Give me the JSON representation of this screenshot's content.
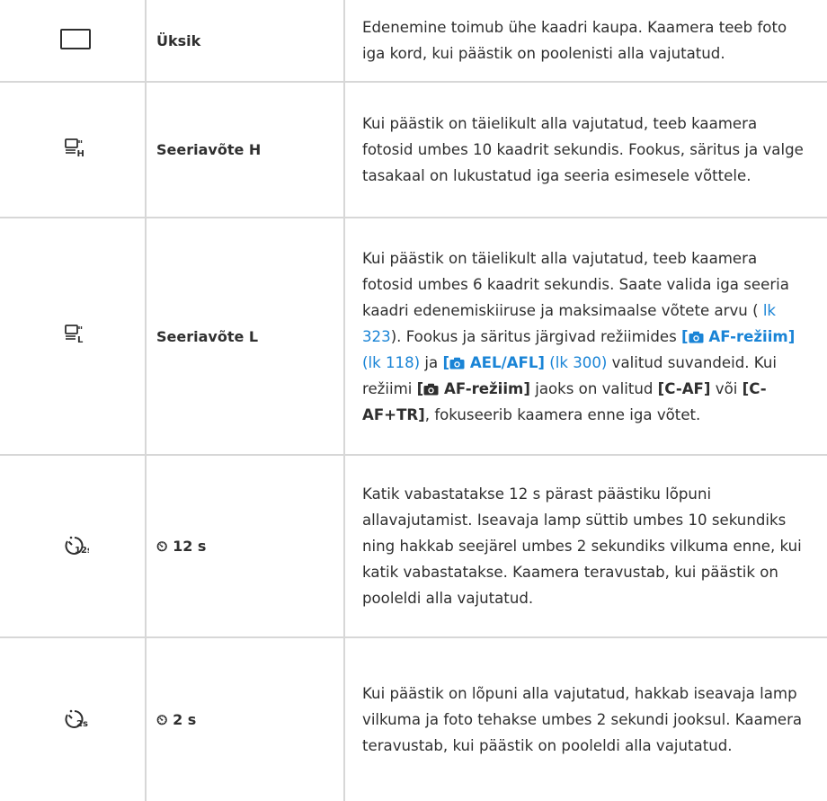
{
  "rows": [
    {
      "icon": "single-frame-icon",
      "label": "Üksik",
      "desc": [
        "Edenemine toimub ühe kaadri kaupa. Kaamera teeb foto iga kord, kui päästik on poolenisti alla vajutatud."
      ]
    },
    {
      "icon": "sequential-high-icon",
      "label": "Seeriavõte H",
      "desc": [
        "Kui päästik on täielikult alla vajutatud, teeb kaamera fotosid umbes 10 kaadrit sekundis. Fookus, säritus ja valge tasakaal on lukustatud iga seeria esimesele võttele."
      ]
    },
    {
      "icon": "sequential-low-icon",
      "label": "Seeriavõte L",
      "desc_parts": {
        "p1": "Kui päästik on täielikult alla vajutatud, teeb kaamera fotosid umbes 6 kaadrit sekundis. Saate valida iga seeria kaadri edenemiskiiruse ja maksimaalse võtete arvu (",
        "link1": " lk 323",
        "p2": "). Fookus ja säritus järgivad režiimides ",
        "af_open": "[",
        "af_text": " AF-režiim]",
        "link2": " (lk 118)",
        "p3": " ja ",
        "ael_open": "[",
        "ael_text": " AEL/AFL]",
        "link3": " (lk 300)",
        "p4": " valitud suvandeid. Kui režiimi ",
        "af2_open": "[",
        "af2_text": " AF-režiim]",
        "p5": " jaoks on valitud ",
        "caf": "[C-AF]",
        "p6": " või ",
        "caftr": "[C-AF+TR]",
        "p7": ", fokuseerib kaamera enne iga võtet."
      }
    },
    {
      "icon": "self-timer-12s-icon",
      "label_symbol": "⏲",
      "label": "12 s",
      "desc": [
        "Katik vabastatakse 12 s pärast päästiku lõpuni allavajutamist. Iseavaja lamp süttib umbes 10 sekundiks ning hakkab seejärel umbes 2 sekundiks vilkuma enne, kui katik vabastatakse. Kaamera teravustab, kui päästik on pooleldi alla vajutatud."
      ]
    },
    {
      "icon": "self-timer-2s-icon",
      "label_symbol": "⏲",
      "label": "2 s",
      "desc": [
        "Kui päästik on lõpuni alla vajutatud, hakkab iseavaja lamp vilkuma ja foto tehakse umbes 2 sekundi jooksul. Kaamera teravustab, kui päästik on pooleldi alla vajutatud."
      ]
    }
  ],
  "colors": {
    "link": "#1a84d6",
    "border": "#d7d7d7",
    "text": "#2f2f2f"
  }
}
